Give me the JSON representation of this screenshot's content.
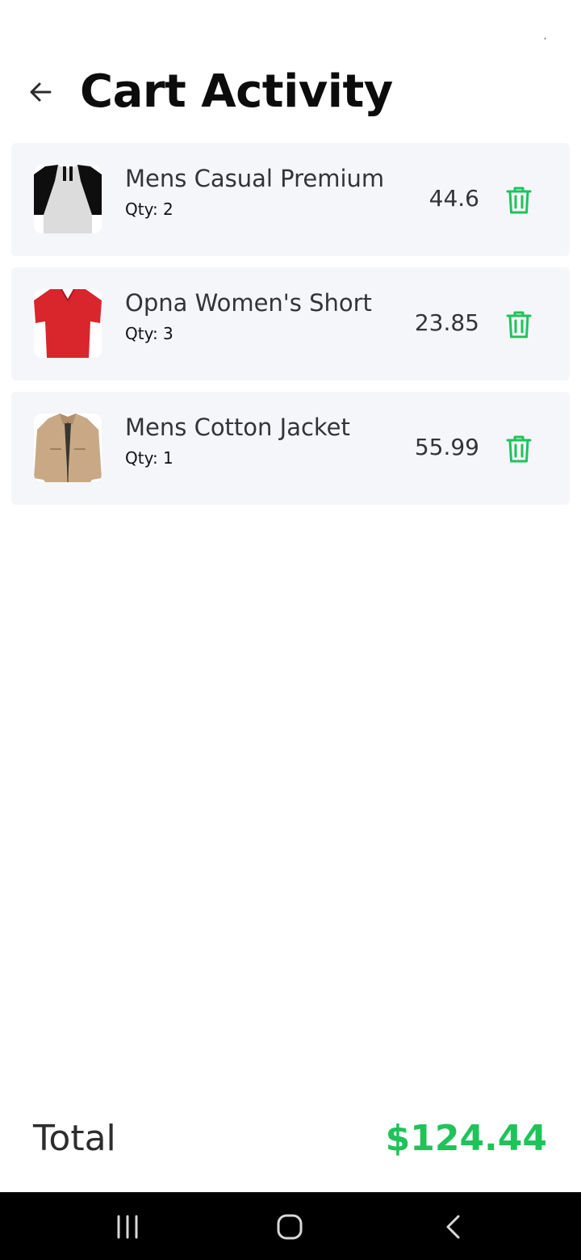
{
  "header": {
    "title": "Cart Activity",
    "back_icon": "arrow-left-icon"
  },
  "cart": {
    "items": [
      {
        "title": "Mens Casual Premium",
        "qty": "Qty: 2",
        "price": "44.6",
        "image": "raglan-tshirt-gray-black"
      },
      {
        "title": "Opna Women's Short",
        "qty": "Qty: 3",
        "price": "23.85",
        "image": "red-vneck-tshirt"
      },
      {
        "title": "Mens Cotton Jacket",
        "qty": "Qty: 1",
        "price": "55.99",
        "image": "beige-cotton-jacket"
      }
    ],
    "delete_icon": "trash-icon"
  },
  "total": {
    "label": "Total",
    "value": "$124.44"
  },
  "colors": {
    "accent": "#1fc35a",
    "card": "#f5f6fa",
    "navbar": "#000000"
  },
  "navbar": {
    "icons": [
      "recents-icon",
      "home-icon",
      "back-nav-icon"
    ]
  }
}
